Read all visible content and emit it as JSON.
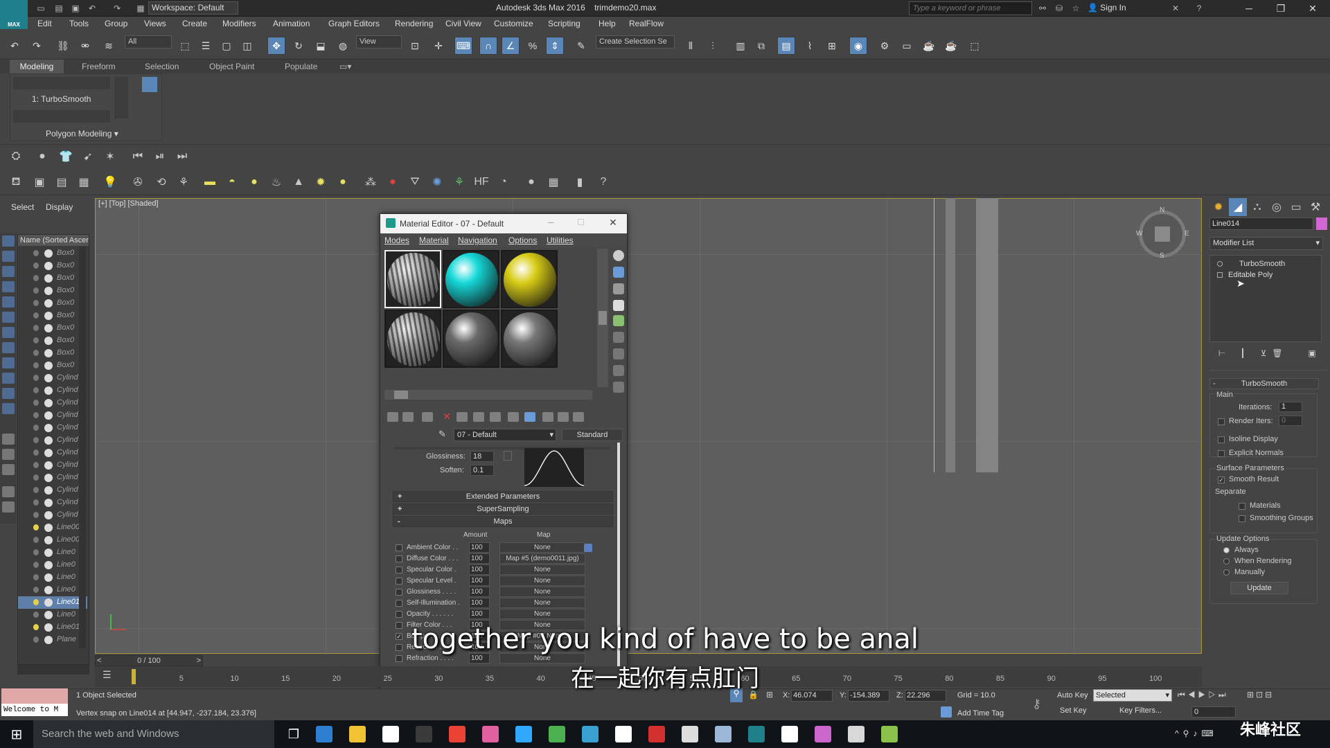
{
  "app": {
    "logo": "MAX",
    "title": "Autodesk 3ds Max 2016",
    "file": "trimdemo20.max",
    "workspace": "Workspace: Default",
    "search_placeholder": "Type a keyword or phrase",
    "sign_in": "Sign In"
  },
  "menu": [
    "Edit",
    "Tools",
    "Group",
    "Views",
    "Create",
    "Modifiers",
    "Animation",
    "Graph Editors",
    "Rendering",
    "Civil View",
    "Customize",
    "Scripting",
    "Help",
    "RealFlow"
  ],
  "maintoolbar": {
    "filter": "All",
    "refcoord": "View",
    "named_selection": "Create Selection Se"
  },
  "ribbon": {
    "tabs": [
      "Modeling",
      "Freeform",
      "Selection",
      "Object Paint",
      "Populate"
    ],
    "modifier_label": "1: TurboSmooth",
    "polygon_modeling": "Polygon Modeling"
  },
  "scene_explorer": {
    "select_tab": "Select",
    "display_tab": "Display",
    "header": "Name (Sorted Ascen",
    "rows": [
      {
        "name": "Box0",
        "light": false,
        "selected": false
      },
      {
        "name": "Box0",
        "light": false,
        "selected": false
      },
      {
        "name": "Box0",
        "light": false,
        "selected": false
      },
      {
        "name": "Box0",
        "light": false,
        "selected": false
      },
      {
        "name": "Box0",
        "light": false,
        "selected": false
      },
      {
        "name": "Box0",
        "light": false,
        "selected": false
      },
      {
        "name": "Box0",
        "light": false,
        "selected": false
      },
      {
        "name": "Box0",
        "light": false,
        "selected": false
      },
      {
        "name": "Box0",
        "light": false,
        "selected": false
      },
      {
        "name": "Box0",
        "light": false,
        "selected": false
      },
      {
        "name": "Cylind",
        "light": false,
        "selected": false
      },
      {
        "name": "Cylind",
        "light": false,
        "selected": false
      },
      {
        "name": "Cylind",
        "light": false,
        "selected": false
      },
      {
        "name": "Cylind",
        "light": false,
        "selected": false
      },
      {
        "name": "Cylind",
        "light": false,
        "selected": false
      },
      {
        "name": "Cylind",
        "light": false,
        "selected": false
      },
      {
        "name": "Cylind",
        "light": false,
        "selected": false
      },
      {
        "name": "Cylind",
        "light": false,
        "selected": false
      },
      {
        "name": "Cylind",
        "light": false,
        "selected": false
      },
      {
        "name": "Cylind",
        "light": false,
        "selected": false
      },
      {
        "name": "Cylind",
        "light": false,
        "selected": false
      },
      {
        "name": "Cylind",
        "light": false,
        "selected": false
      },
      {
        "name": "Line00",
        "light": true,
        "selected": false
      },
      {
        "name": "Line00",
        "light": false,
        "selected": false
      },
      {
        "name": "Line0",
        "light": false,
        "selected": false
      },
      {
        "name": "Line0",
        "light": false,
        "selected": false
      },
      {
        "name": "Line0",
        "light": false,
        "selected": false
      },
      {
        "name": "Line0",
        "light": false,
        "selected": false
      },
      {
        "name": "Line01",
        "light": true,
        "selected": true
      },
      {
        "name": "Line0",
        "light": false,
        "selected": false
      },
      {
        "name": "Line01",
        "light": true,
        "selected": false
      },
      {
        "name": "Plane",
        "light": false,
        "selected": false
      }
    ]
  },
  "viewport": {
    "label": "[+] [Top] [Shaded]",
    "compass": {
      "n": "N",
      "s": "S",
      "e": "E",
      "w": "W"
    }
  },
  "material_editor": {
    "title": "Material Editor - 07 - Default",
    "menu": [
      "Modes",
      "Material",
      "Navigation",
      "Options",
      "Utilities"
    ],
    "slots": [
      {
        "kind": "bump",
        "color": "#9a9a9a"
      },
      {
        "kind": "plain",
        "color": "#16d8d8"
      },
      {
        "kind": "plain",
        "color": "#d8cc16"
      },
      {
        "kind": "bump",
        "color": "#8a8a8a"
      },
      {
        "kind": "plain",
        "color": "#6a6a6a"
      },
      {
        "kind": "plain",
        "color": "#777777"
      }
    ],
    "material_name": "07 - Default",
    "material_type": "Standard",
    "glossiness_label": "Glossiness:",
    "glossiness": "18",
    "soften_label": "Soften:",
    "soften": "0.1",
    "rollouts": {
      "extended": "Extended Parameters",
      "supersampling": "SuperSampling",
      "maps": "Maps"
    },
    "maps_header": {
      "amount": "Amount",
      "map": "Map"
    },
    "maps": [
      {
        "label": "Ambient Color . .",
        "amount": "100",
        "map": "None",
        "checked": false
      },
      {
        "label": "Diffuse Color . . .",
        "amount": "100",
        "map": "Map #5 (demo0011.jpg)",
        "checked": false
      },
      {
        "label": "Specular Color .",
        "amount": "100",
        "map": "None",
        "checked": false
      },
      {
        "label": "Specular Level .",
        "amount": "100",
        "map": "None",
        "checked": false
      },
      {
        "label": "Glossiness . . . .",
        "amount": "100",
        "map": "None",
        "checked": false
      },
      {
        "label": "Self-Illumination .",
        "amount": "100",
        "map": "None",
        "checked": false
      },
      {
        "label": "Opacity . . . . . .",
        "amount": "100",
        "map": "None",
        "checked": false
      },
      {
        "label": "Filter Color . . .",
        "amount": "100",
        "map": "None",
        "checked": false
      },
      {
        "label": "Bump . . . . . . .",
        "amount": "100",
        "map": "Map #0 ( Norma",
        "checked": true
      },
      {
        "label": "Reflection . . . .",
        "amount": "100",
        "map": "None",
        "checked": false
      },
      {
        "label": "Refraction . . . .",
        "amount": "100",
        "map": "None",
        "checked": false
      }
    ]
  },
  "command_panel": {
    "object_name": "Line014",
    "object_color": "#d466d4",
    "modifier_list": "Modifier List",
    "stack": [
      "TurboSmooth",
      "Editable Poly"
    ],
    "turbosmooth": {
      "title": "TurboSmooth",
      "main": "Main",
      "iterations_label": "Iterations:",
      "iterations": "1",
      "render_iters_label": "Render Iters:",
      "render_iters": "0",
      "isoline": "Isoline Display",
      "explicit_normals": "Explicit Normals",
      "surface_params": "Surface Parameters",
      "smooth_result": "Smooth Result",
      "separate": "Separate",
      "materials": "Materials",
      "smoothing_groups": "Smoothing Groups",
      "update_options": "Update Options",
      "always": "Always",
      "when_rendering": "When Rendering",
      "manually": "Manually",
      "update": "Update"
    }
  },
  "timeline": {
    "slider": "0 / 100",
    "ticks": [
      "0",
      "5",
      "10",
      "15",
      "20",
      "25",
      "30",
      "35",
      "40",
      "45",
      "50",
      "55",
      "60",
      "65",
      "70",
      "75",
      "80",
      "85",
      "90",
      "95",
      "100"
    ]
  },
  "status": {
    "welcome": "Welcome to M",
    "selected": "1 Object Selected",
    "prompt": "Vertex snap on Line014 at [44.947, -237.184, 23.376]",
    "x_label": "X:",
    "x": "46.074",
    "y_label": "Y:",
    "y": "-154.389",
    "z_label": "Z:",
    "z": "22.296",
    "grid": "Grid = 10.0",
    "auto_key": "Auto Key",
    "selected_drop": "Selected",
    "set_key": "Set Key",
    "key_filters": "Key Filters...",
    "add_time_tag": "Add Time Tag",
    "frame": "0"
  },
  "subtitles": {
    "en": "together you kind of have to be anal",
    "zh": "在一起你有点肛门"
  },
  "taskbar": {
    "search": "Search the web and Windows",
    "apps": [
      "#2d7dd2",
      "#f1c232",
      "#ffffff",
      "#3a3a3a",
      "#e94235",
      "#e060a0",
      "#31a8ff",
      "#4caf50",
      "#39a0d0",
      "#ffffff",
      "#d32f2f",
      "#dddddd",
      "#9db7d8",
      "#1f7f8a",
      "#ffffff",
      "#cc66cc",
      "#d8d8d8",
      "#8bc34a"
    ]
  },
  "watermark": "朱峰社区"
}
